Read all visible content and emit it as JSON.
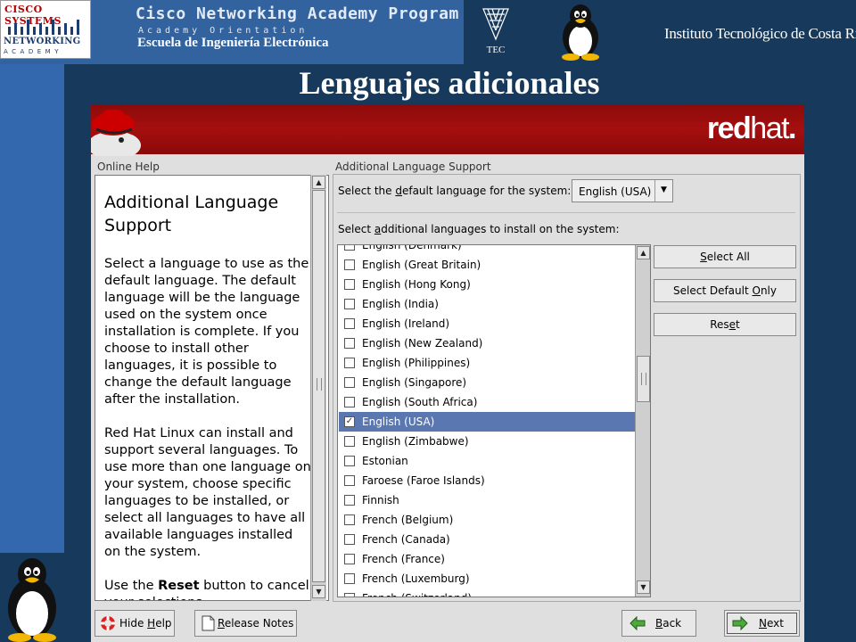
{
  "slide": {
    "title": "Lenguajes adicionales",
    "banner": {
      "cisco_name": "CISCO SYSTEMS",
      "cisco_academy_line1": "NETWORKING",
      "cisco_academy_line2": "ACADEMY",
      "program_title": "Cisco Networking Academy Program",
      "program_subtitle": "Academy Orientation",
      "school": "Escuela de Ingeniería Electrónica",
      "tec_label": "TEC",
      "institute": "Instituto Tecnológico de Costa Rica"
    }
  },
  "installer": {
    "brand": {
      "bold": "red",
      "light": "hat",
      "dot": "."
    },
    "help": {
      "caption": "Online Help",
      "heading": "Additional Language Support",
      "para1": "Select a language to use as the default language. The default language will be the language used on the system once installation is complete. If you choose to install other languages, it is possible to change the default language after the installation.",
      "para2": "Red Hat Linux can install and support several languages. To use more than one language on your system, choose specific languages to be installed, or select all languages to have all available languages installed on the system.",
      "para3_before": "Use the ",
      "para3_bold": "Reset",
      "para3_after": " button to cancel your selections."
    },
    "language": {
      "caption": "Additional Language Support",
      "default_label_pre": "Select the ",
      "default_label_key": "d",
      "default_label_post": "efault language for the system:",
      "default_value": "English (USA)",
      "additional_label_pre": "Select ",
      "additional_label_key": "a",
      "additional_label_post": "dditional languages to install on the system:",
      "items": [
        {
          "label": "English (Denmark)",
          "checked": false
        },
        {
          "label": "English (Great Britain)",
          "checked": false
        },
        {
          "label": "English (Hong Kong)",
          "checked": false
        },
        {
          "label": "English (India)",
          "checked": false
        },
        {
          "label": "English (Ireland)",
          "checked": false
        },
        {
          "label": "English (New Zealand)",
          "checked": false
        },
        {
          "label": "English (Philippines)",
          "checked": false
        },
        {
          "label": "English (Singapore)",
          "checked": false
        },
        {
          "label": "English (South Africa)",
          "checked": false
        },
        {
          "label": "English (USA)",
          "checked": true,
          "selected": true
        },
        {
          "label": "English (Zimbabwe)",
          "checked": false
        },
        {
          "label": "Estonian",
          "checked": false
        },
        {
          "label": "Faroese (Faroe Islands)",
          "checked": false
        },
        {
          "label": "Finnish",
          "checked": false
        },
        {
          "label": "French (Belgium)",
          "checked": false
        },
        {
          "label": "French (Canada)",
          "checked": false
        },
        {
          "label": "French (France)",
          "checked": false
        },
        {
          "label": "French (Luxemburg)",
          "checked": false
        },
        {
          "label": "French (Switzerland)",
          "checked": false
        }
      ]
    },
    "buttons": {
      "select_all": {
        "pre": "",
        "key": "S",
        "post": "elect All"
      },
      "select_default": {
        "pre": "Select Default ",
        "key": "O",
        "post": "nly"
      },
      "reset": {
        "pre": "Res",
        "key": "e",
        "post": "t"
      },
      "hide_help": {
        "pre": "Hide ",
        "key": "H",
        "post": "elp"
      },
      "release_notes": {
        "pre": "",
        "key": "R",
        "post": "elease Notes"
      },
      "back": {
        "pre": "",
        "key": "B",
        "post": "ack"
      },
      "next": {
        "pre": "",
        "key": "N",
        "post": "ext"
      }
    }
  }
}
